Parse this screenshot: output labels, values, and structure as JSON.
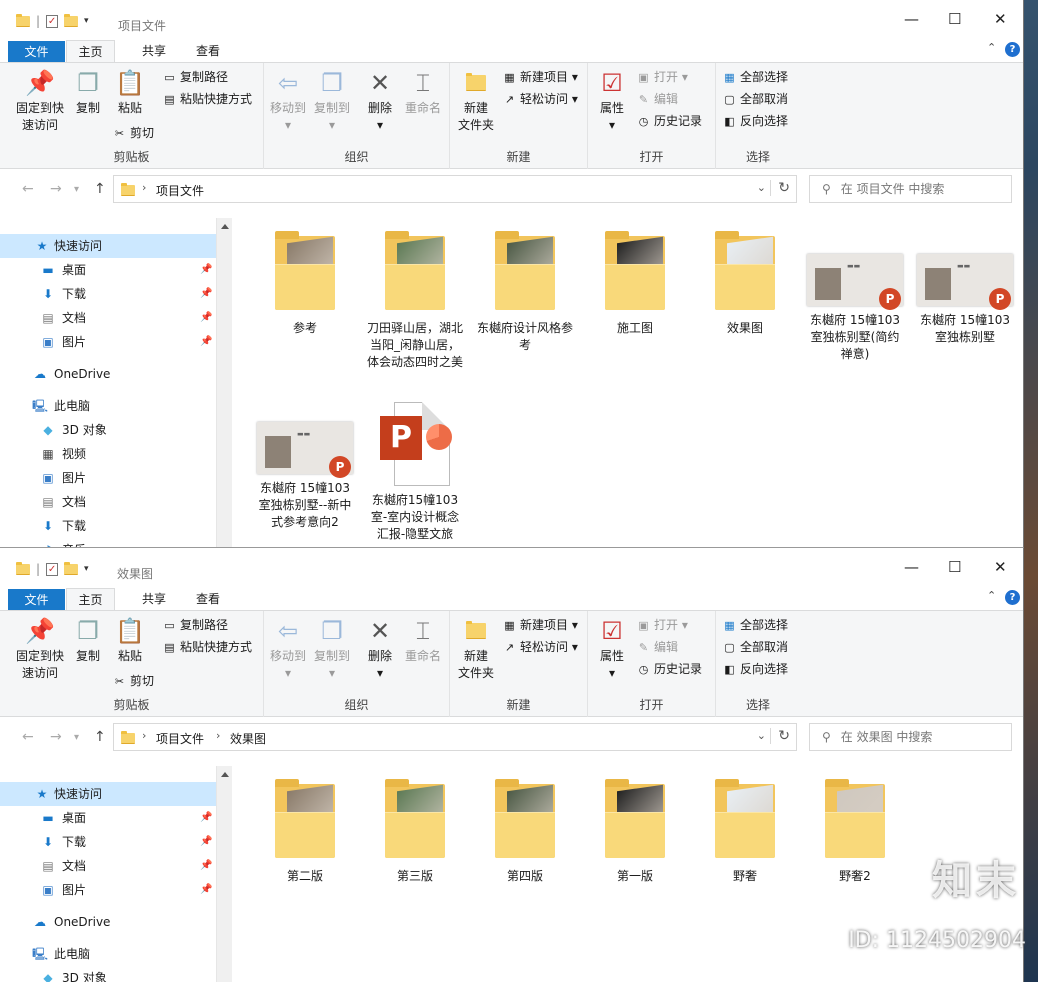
{
  "watermark": {
    "brand": "知末",
    "id": "ID: 1124502904"
  },
  "ribbon_labels": {
    "pin": [
      "固定到快",
      "速访问"
    ],
    "copy": "复制",
    "paste": "粘贴",
    "copy_path": "复制路径",
    "paste_shortcut": "粘贴快捷方式",
    "cut": "剪切",
    "clipboard": "剪贴板",
    "move_to": "移动到",
    "copy_to": "复制到",
    "delete": "删除",
    "rename": "重命名",
    "organize": "组织",
    "new_folder": [
      "新建",
      "文件夹"
    ],
    "new_item": "新建项目",
    "easy_access": "轻松访问",
    "new": "新建",
    "properties": "属性",
    "open": "打开",
    "edit": "编辑",
    "history": "历史记录",
    "open_group": "打开",
    "select_all": "全部选择",
    "select_none": "全部取消",
    "invert": "反向选择",
    "select": "选择"
  },
  "tabs": {
    "file": "文件",
    "home": "主页",
    "share": "共享",
    "view": "查看"
  },
  "nav": {
    "quick": "快速访问",
    "desktop": "桌面",
    "downloads": "下载",
    "docs": "文档",
    "pics": "图片",
    "onedrive": "OneDrive",
    "pc": "此电脑",
    "obj3d": "3D 对象",
    "video": "视频",
    "music": "音乐"
  },
  "window1": {
    "title": "项目文件",
    "path": [
      "项目文件"
    ],
    "search_placeholder": "在 项目文件 中搜索",
    "items": [
      {
        "label": "参考",
        "type": "folder"
      },
      {
        "label": "刀田驿山居，湖北当阳_闲静山居，体会动态四时之美",
        "type": "folder"
      },
      {
        "label": "东樾府设计风格参考",
        "type": "folder"
      },
      {
        "label": "施工图",
        "type": "folder"
      },
      {
        "label": "效果图",
        "type": "folder"
      },
      {
        "label": "东樾府  15幢103室独栋别墅(简约禅意)",
        "type": "ppt"
      },
      {
        "label": "东樾府  15幢103室独栋别墅",
        "type": "ppt"
      },
      {
        "label": "东樾府  15幢103室独栋别墅--新中式参考意向2",
        "type": "ppt"
      },
      {
        "label": "东樾府15幢103室-室内设计概念汇报-隐墅文旅",
        "type": "pptfile"
      }
    ]
  },
  "window2": {
    "title": "效果图",
    "path": [
      "项目文件",
      "效果图"
    ],
    "search_placeholder": "在 效果图 中搜索",
    "items": [
      {
        "label": "第二版",
        "type": "folder"
      },
      {
        "label": "第三版",
        "type": "folder"
      },
      {
        "label": "第四版",
        "type": "folder"
      },
      {
        "label": "第一版",
        "type": "folder"
      },
      {
        "label": "野奢",
        "type": "folder"
      },
      {
        "label": "野奢2",
        "type": "folder"
      }
    ]
  },
  "colors": {
    "accent": "#1979ca",
    "folder": "#f7d36b",
    "selection": "#cce8ff",
    "ppt": "#d24726"
  }
}
